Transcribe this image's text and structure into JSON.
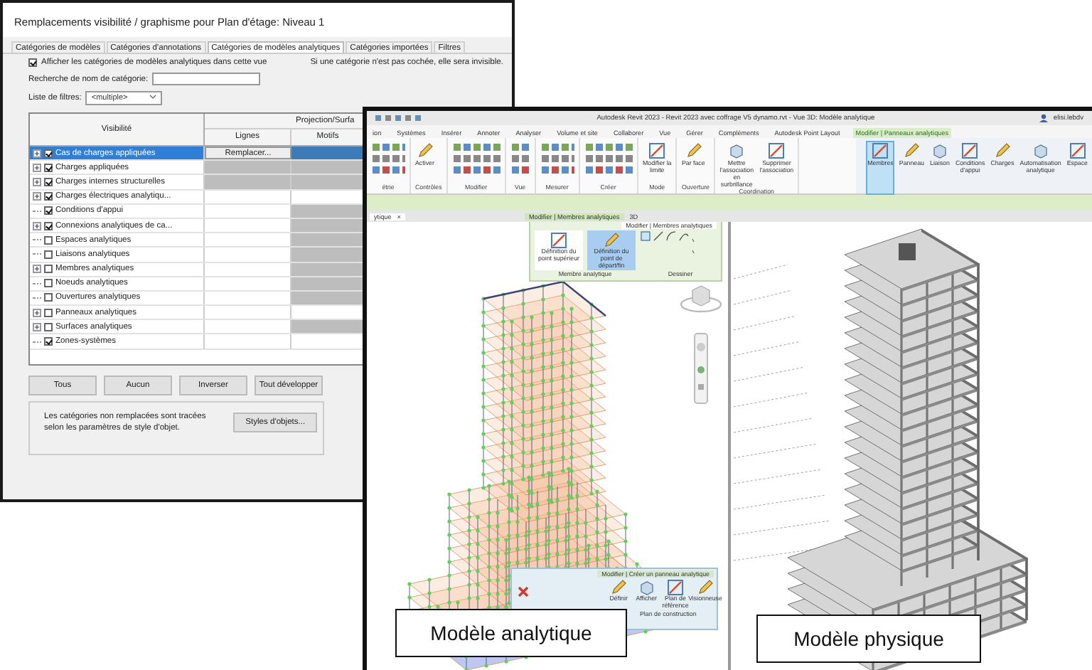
{
  "dialog": {
    "title": "Remplacements visibilité / graphisme pour Plan d'étage: Niveau 1",
    "tabs": [
      {
        "label": "Catégories de modèles",
        "selected": false
      },
      {
        "label": "Catégories d'annotations",
        "selected": false
      },
      {
        "label": "Catégories de modèles analytiques",
        "selected": true
      },
      {
        "label": "Catégories importées",
        "selected": false
      },
      {
        "label": "Filtres",
        "selected": false
      }
    ],
    "show_analytic": {
      "label": "Afficher les catégories de modèles analytiques dans cette vue",
      "checked": true
    },
    "hint": "Si une catégorie n'est pas cochée, elle sera invisible.",
    "search": {
      "label": "Recherche de nom de catégorie:"
    },
    "filter": {
      "label": "Liste de filtres:",
      "value": "<multiple>"
    },
    "table": {
      "columns": [
        "Visibilité",
        "Projection/Surfa",
        "Lignes",
        "Motifs"
      ],
      "rows": [
        {
          "name": "Cas de charges appliquées",
          "checked": true,
          "expandable": true,
          "selected": true,
          "override": "Remplacer..."
        },
        {
          "name": "Charges appliquées",
          "checked": true,
          "expandable": true,
          "selected": false,
          "lines_shaded": true,
          "patterns_shaded": true
        },
        {
          "name": "Charges internes structurelles",
          "checked": true,
          "expandable": true,
          "selected": false,
          "lines_shaded": true,
          "patterns_shaded": true
        },
        {
          "name": "Charges électriques analytiqu...",
          "checked": true,
          "expandable": true,
          "selected": false,
          "lines_shaded": false,
          "patterns_shaded": false
        },
        {
          "name": "Conditions d'appui",
          "checked": true,
          "expandable": false,
          "selected": false,
          "lines_shaded": false,
          "patterns_shaded": true
        },
        {
          "name": "Connexions analytiques de ca...",
          "checked": true,
          "expandable": true,
          "selected": false,
          "lines_shaded": false,
          "patterns_shaded": true
        },
        {
          "name": "Espaces analytiques",
          "checked": false,
          "expandable": false,
          "selected": false,
          "lines_shaded": false,
          "patterns_shaded": true
        },
        {
          "name": "Liaisons analytiques",
          "checked": false,
          "expandable": false,
          "selected": false,
          "lines_shaded": false,
          "patterns_shaded": true
        },
        {
          "name": "Membres analytiques",
          "checked": false,
          "expandable": true,
          "selected": false,
          "lines_shaded": false,
          "patterns_shaded": true
        },
        {
          "name": "Noeuds analytiques",
          "checked": false,
          "expandable": false,
          "selected": false,
          "lines_shaded": false,
          "patterns_shaded": true
        },
        {
          "name": "Ouvertures analytiques",
          "checked": false,
          "expandable": false,
          "selected": false,
          "lines_shaded": false,
          "patterns_shaded": true
        },
        {
          "name": "Panneaux analytiques",
          "checked": false,
          "expandable": true,
          "selected": false,
          "lines_shaded": false,
          "patterns_shaded": false
        },
        {
          "name": "Surfaces analytiques",
          "checked": false,
          "expandable": true,
          "selected": false,
          "lines_shaded": false,
          "patterns_shaded": true
        },
        {
          "name": "Zones-systèmes",
          "checked": true,
          "expandable": false,
          "selected": false,
          "lines_shaded": false,
          "patterns_shaded": false
        }
      ]
    },
    "buttons": [
      "Tous",
      "Aucun",
      "Inverser",
      "Tout développer"
    ],
    "note": "Les catégories non remplacées sont tracées selon les paramètres de style d'objet.",
    "note_button": "Styles d'objets..."
  },
  "revit": {
    "title": "Autodesk Revit 2023 - Revit 2023 avec coffrage V5 dynamo.rvt - Vue 3D: Modèle analytique",
    "user": "elisi.lebdv",
    "ribbon_tabs": [
      {
        "label": "ion",
        "selected": false
      },
      {
        "label": "Systèmes",
        "selected": false
      },
      {
        "label": "Insérer",
        "selected": false
      },
      {
        "label": "Annoter",
        "selected": false
      },
      {
        "label": "Analyser",
        "selected": false
      },
      {
        "label": "Volume et site",
        "selected": false
      },
      {
        "label": "Collaborer",
        "selected": false
      },
      {
        "label": "Vue",
        "selected": false
      },
      {
        "label": "Gérer",
        "selected": false
      },
      {
        "label": "Compléments",
        "selected": false
      },
      {
        "label": "Autodesk Point Layout",
        "selected": false
      },
      {
        "label": "Modifier | Panneaux analytiques",
        "selected": true
      }
    ],
    "panels": [
      {
        "label": "étrie"
      },
      {
        "label": "Contrôles",
        "tools": [
          {
            "label": "Activer",
            "selected": false
          }
        ]
      },
      {
        "label": "Modifier"
      },
      {
        "label": "Vue"
      },
      {
        "label": "Mesurer"
      },
      {
        "label": "Créer"
      },
      {
        "label": "Mode",
        "tools": [
          {
            "label": "Modifier la limite",
            "selected": false
          }
        ]
      },
      {
        "label": "Ouverture",
        "tools": [
          {
            "label": "Par face",
            "selected": false
          }
        ]
      },
      {
        "label": "Coordination",
        "tools": [
          {
            "label": "Mettre l'association en surbrillance",
            "selected": false
          },
          {
            "label": "Supprimer l'association",
            "selected": false
          }
        ]
      }
    ],
    "analytic_tools": [
      {
        "label": "Membres",
        "selected": true
      },
      {
        "label": "Panneau",
        "selected": false
      },
      {
        "label": "Liaison",
        "selected": false
      },
      {
        "label": "Conditions d'appui",
        "selected": false
      },
      {
        "label": "Charges",
        "selected": false
      },
      {
        "label": "Automatisation analytique",
        "selected": false
      },
      {
        "label": "Espace",
        "selected": false
      }
    ],
    "view_tab": "ytique",
    "view_close": "×",
    "context_label": "Modifier | Membres analytiques",
    "view_label": "3D",
    "member_panel": {
      "title": "Modifier | Membres analytiques",
      "tools": [
        {
          "label": "Définition du point supérieur",
          "selected": false
        },
        {
          "label": "Définition du point de départ/fin",
          "selected": true
        }
      ],
      "groups": [
        "Membre analytique",
        "Dessiner"
      ]
    },
    "panel_popup": {
      "title": "Modifier | Créer un panneau analytique",
      "tools": [
        "Définir",
        "Afficher",
        "Plan de référence",
        "Visionneuse"
      ],
      "group": "Plan de construction"
    },
    "captions": [
      "Modèle analytique",
      "Modèle physique"
    ]
  }
}
